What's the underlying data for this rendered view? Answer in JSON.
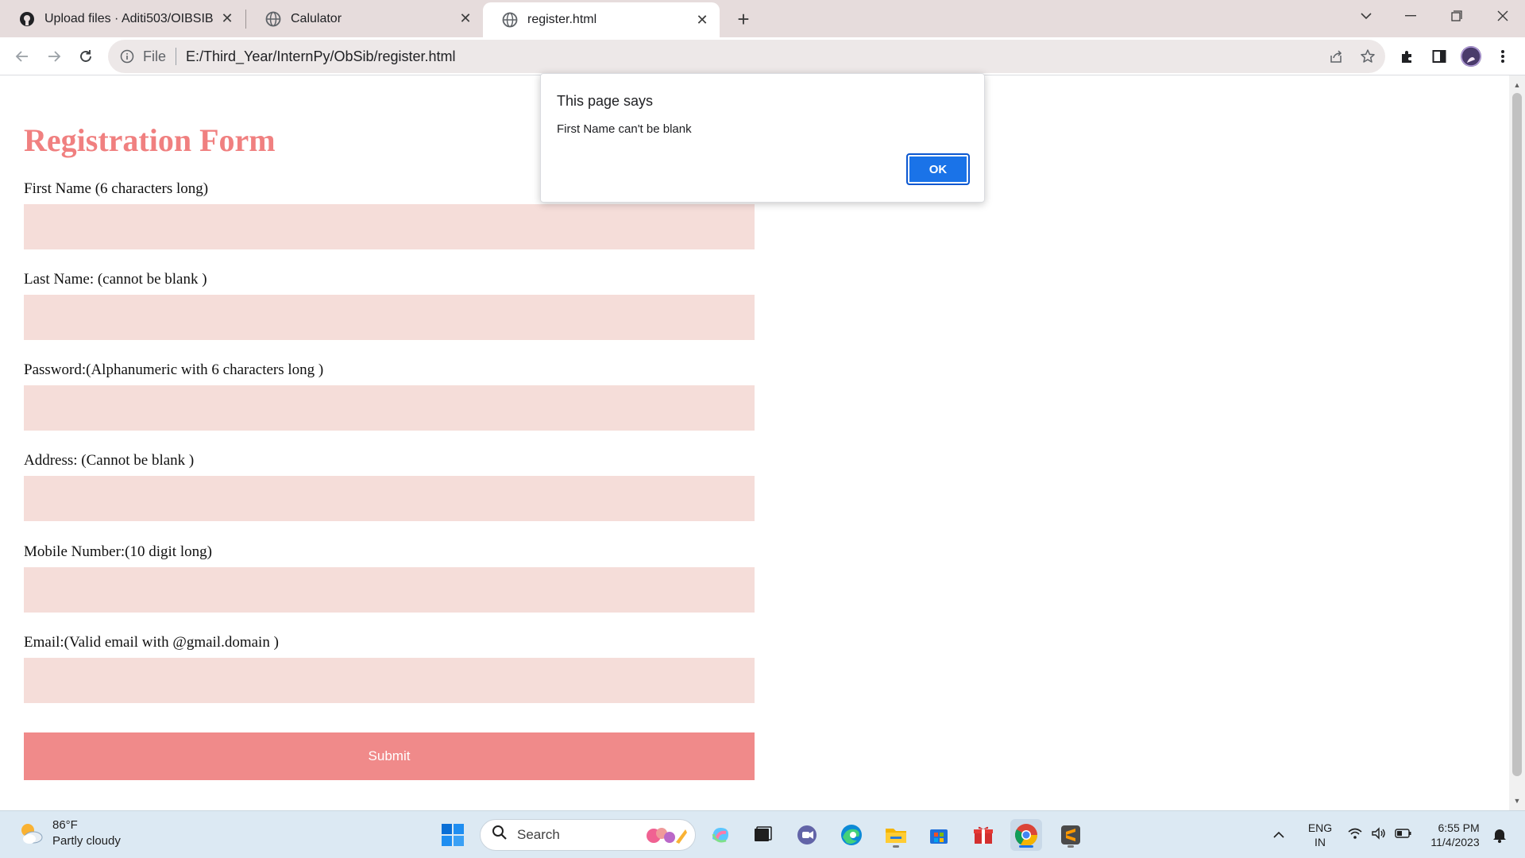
{
  "browser": {
    "tabs": [
      {
        "title": "Upload files · Aditi503/OIBSIB",
        "icon": "github-icon",
        "active": false
      },
      {
        "title": "Calulator",
        "icon": "globe-icon",
        "active": false
      },
      {
        "title": "register.html",
        "icon": "globe-icon",
        "active": true
      }
    ],
    "omnibox": {
      "scheme_label": "File",
      "url": "E:/Third_Year/InternPy/ObSib/register.html"
    }
  },
  "page": {
    "title": "Registration Form",
    "fields": [
      {
        "label": "First Name (6 characters long)",
        "value": ""
      },
      {
        "label": "Last Name: (cannot be blank )",
        "value": ""
      },
      {
        "label": "Password:(Alphanumeric with 6 characters long )",
        "value": ""
      },
      {
        "label": "Address: (Cannot be blank )",
        "value": ""
      },
      {
        "label": "Mobile Number:(10 digit long)",
        "value": ""
      },
      {
        "label": "Email:(Valid email with @gmail.domain )",
        "value": ""
      }
    ],
    "submit_label": "Submit",
    "colors": {
      "title": "#f08080",
      "input_bg": "#f5ddd9",
      "button_bg": "#f08a8a"
    }
  },
  "alert": {
    "title": "This page says",
    "message": "First Name can't be blank",
    "ok_label": "OK"
  },
  "taskbar": {
    "weather": {
      "temp": "86°F",
      "condition": "Partly cloudy"
    },
    "search_label": "Search",
    "language": {
      "line1": "ENG",
      "line2": "IN"
    },
    "clock": {
      "time": "6:55 PM",
      "date": "11/4/2023"
    }
  }
}
